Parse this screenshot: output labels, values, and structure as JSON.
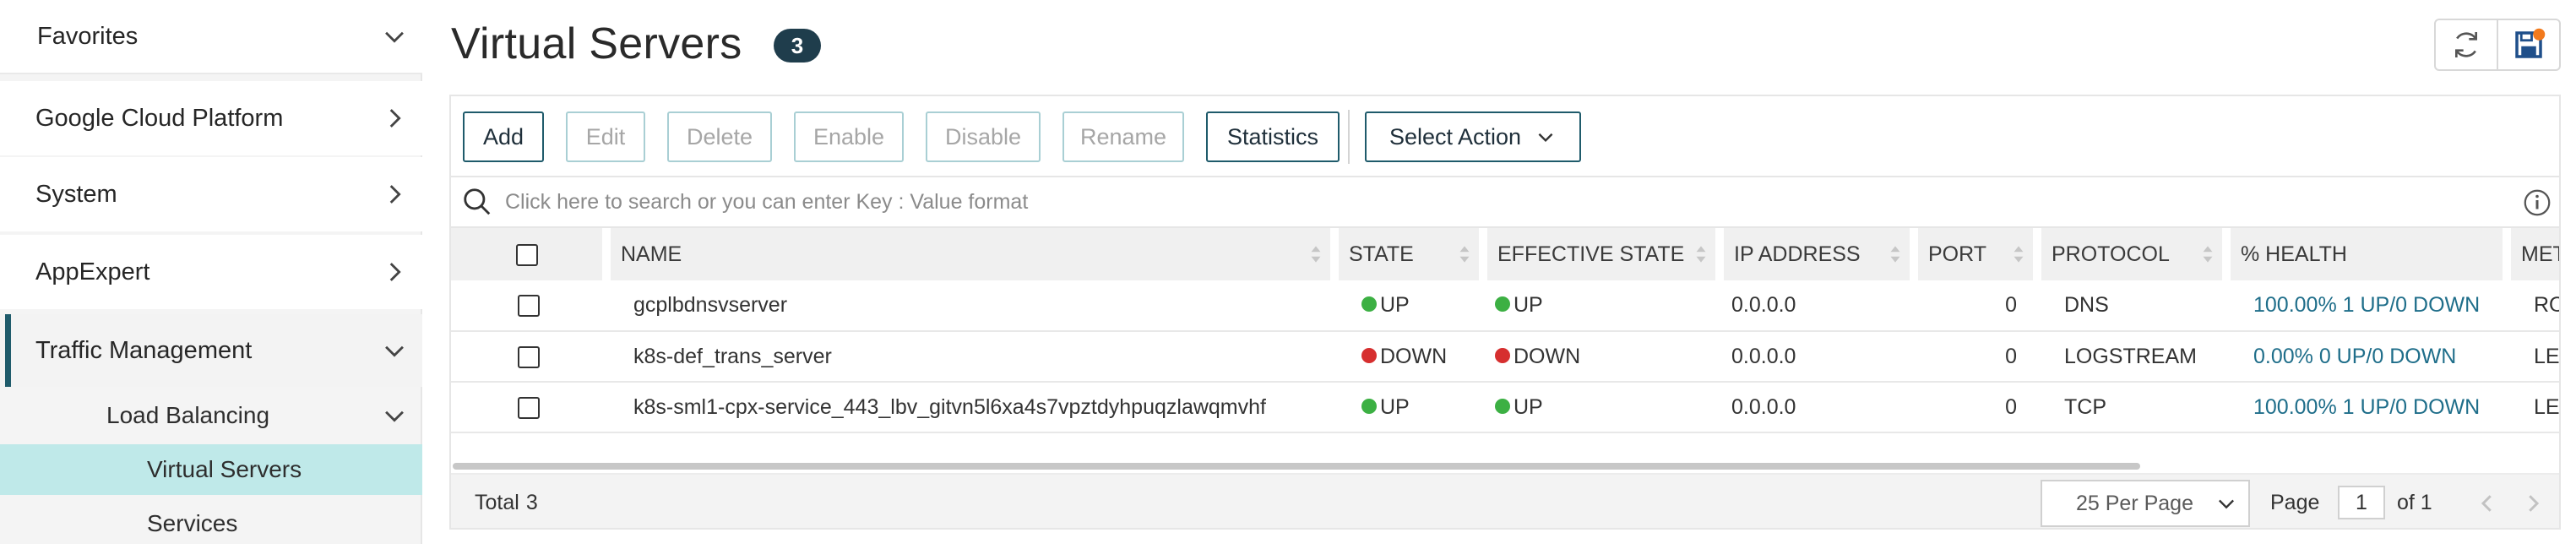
{
  "sidebar": {
    "items": [
      {
        "label": "Favorites",
        "chevron": "down"
      },
      {
        "label": "Google Cloud Platform",
        "chevron": "right"
      },
      {
        "label": "System",
        "chevron": "right"
      },
      {
        "label": "AppExpert",
        "chevron": "right"
      },
      {
        "label": "Traffic Management",
        "chevron": "down",
        "active": true
      }
    ],
    "sub": {
      "label": "Load Balancing",
      "chevron": "down"
    },
    "subsub": [
      {
        "label": "Virtual Servers",
        "selected": true
      },
      {
        "label": "Services"
      }
    ]
  },
  "header": {
    "title": "Virtual Servers",
    "count": "3",
    "icons": [
      "refresh-icon",
      "save-icon"
    ]
  },
  "toolbar": {
    "buttons": [
      {
        "label": "Add",
        "enabled": true
      },
      {
        "label": "Edit",
        "enabled": false
      },
      {
        "label": "Delete",
        "enabled": false
      },
      {
        "label": "Enable",
        "enabled": false
      },
      {
        "label": "Disable",
        "enabled": false
      },
      {
        "label": "Rename",
        "enabled": false
      },
      {
        "label": "Statistics",
        "enabled": true
      }
    ],
    "select_action": "Select Action"
  },
  "search": {
    "placeholder": "Click here to search or you can enter Key : Value format",
    "icon": "search-icon",
    "info_icon": "info-icon"
  },
  "table": {
    "columns": [
      "NAME",
      "STATE",
      "EFFECTIVE STATE",
      "IP ADDRESS",
      "PORT",
      "PROTOCOL",
      "% HEALTH",
      "METH"
    ],
    "rows": [
      {
        "name": "gcplbdnsvserver",
        "state": "UP",
        "effective_state": "UP",
        "ip": "0.0.0.0",
        "port": "0",
        "protocol": "DNS",
        "health": "100.00% 1 UP/0 DOWN",
        "method": "ROUN"
      },
      {
        "name": "k8s-def_trans_server",
        "state": "DOWN",
        "effective_state": "DOWN",
        "ip": "0.0.0.0",
        "port": "0",
        "protocol": "LOGSTREAM",
        "health": "0.00% 0 UP/0 DOWN",
        "method": "LEAST"
      },
      {
        "name": "k8s-sml1-cpx-service_443_lbv_gitvn5l6xa4s7vpztdyhpuqzlawqmvhf",
        "state": "UP",
        "effective_state": "UP",
        "ip": "0.0.0.0",
        "port": "0",
        "protocol": "TCP",
        "health": "100.00% 1 UP/0 DOWN",
        "method": "LEAST"
      }
    ]
  },
  "footer": {
    "total_label": "Total",
    "total": "3",
    "per_page": "25 Per Page",
    "page_label": "Page",
    "page": "1",
    "of_label": "of 1"
  },
  "colors": {
    "accent": "#1f5b6b",
    "up": "#3cb043",
    "down": "#d62f2f",
    "selected_bg": "#bfe9e9",
    "link": "#1f6e8a"
  }
}
